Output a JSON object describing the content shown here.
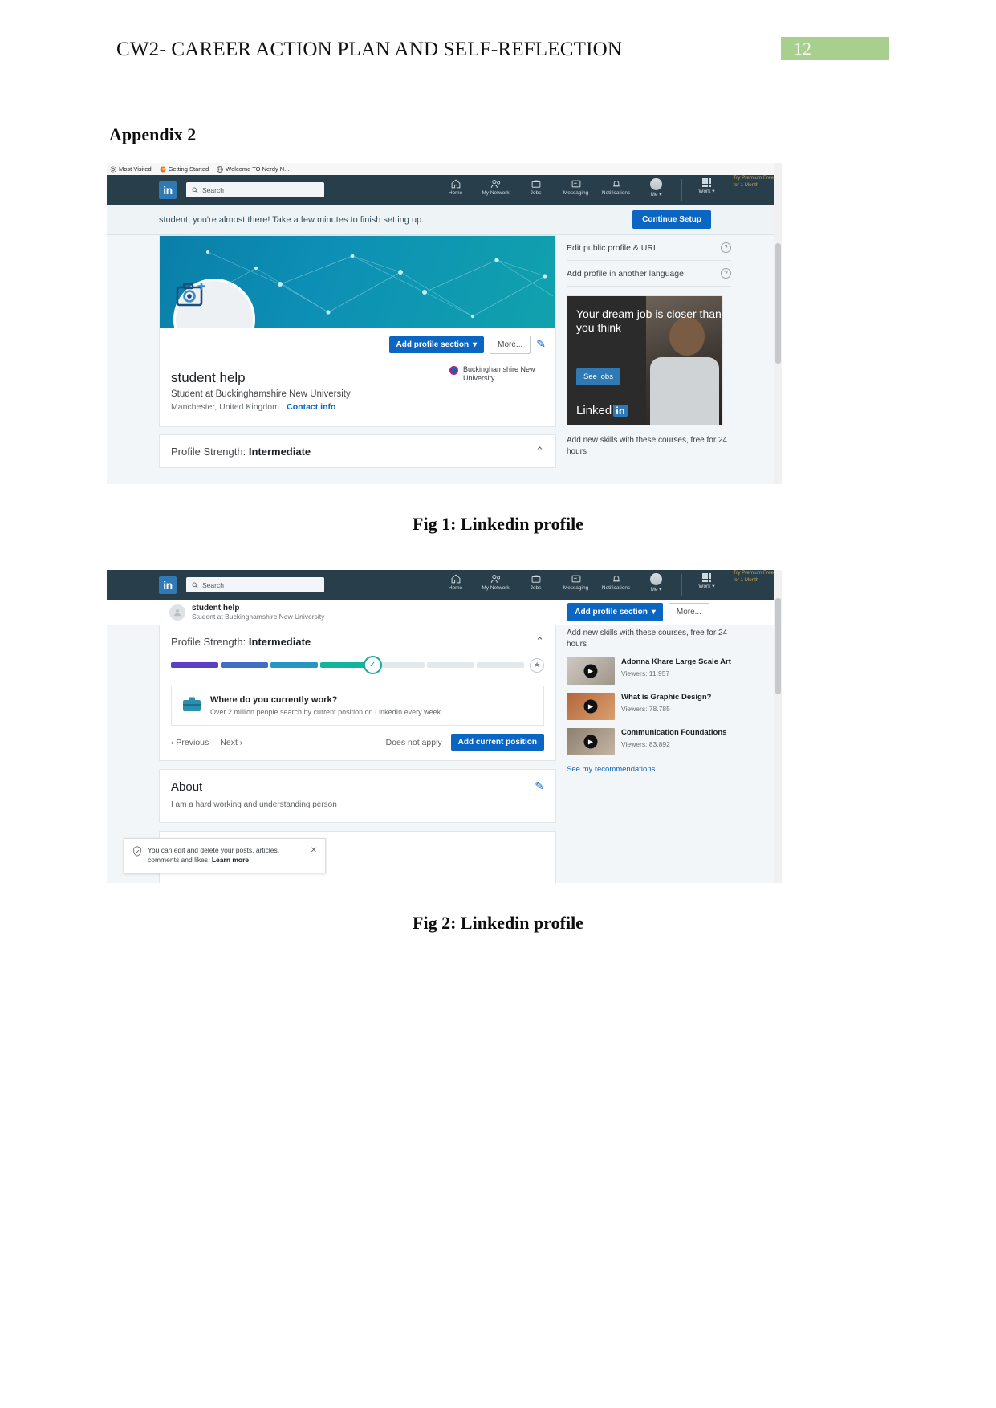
{
  "document": {
    "header_title": "CW2- CAREER ACTION PLAN AND SELF-REFLECTION",
    "page_number": "12",
    "appendix_title": "Appendix 2",
    "fig1_caption": "Fig 1: Linkedin profile",
    "fig2_caption": "Fig 2: Linkedin profile"
  },
  "browser": {
    "bookmarks": [
      {
        "label": "Most Visited",
        "icon": "gear-icon"
      },
      {
        "label": "Getting Started",
        "icon": "firefox-icon"
      },
      {
        "label": "Welcome TO Nerdy N...",
        "icon": "globe-icon"
      }
    ]
  },
  "linkedin_nav": {
    "logo": "in",
    "search_placeholder": "Search",
    "items": [
      {
        "label": "Home",
        "icon": "home-icon"
      },
      {
        "label": "My Network",
        "icon": "people-icon"
      },
      {
        "label": "Jobs",
        "icon": "briefcase-icon"
      },
      {
        "label": "Messaging",
        "icon": "message-icon"
      },
      {
        "label": "Notifications",
        "icon": "bell-icon"
      },
      {
        "label": "Me",
        "icon": "avatar-icon"
      }
    ],
    "work_label": "Work",
    "premium_line1": "Try Premium Free",
    "premium_line2": "for 1 Month"
  },
  "fig1": {
    "setup_banner": {
      "text": "student, you're almost there! Take a few minutes to finish setting up.",
      "button": "Continue Setup"
    },
    "profile": {
      "name": "student help",
      "headline": "Student at Buckinghamshire New University",
      "location": "Manchester, United Kingdom",
      "separator": "·",
      "contact_info": "Contact info",
      "school": "Buckinghamshire New University",
      "add_section_button": "Add profile section",
      "more_button": "More...",
      "edit_icon": "pencil-icon",
      "avatar_icon": "camera-add-icon"
    },
    "strength": {
      "label": "Profile Strength:",
      "value": "Intermediate"
    },
    "sidebar": {
      "links": [
        {
          "label": "Edit public profile & URL",
          "help": "?"
        },
        {
          "label": "Add profile in another language",
          "help": "?"
        }
      ],
      "ad": {
        "headline": "Your dream job is closer than you think",
        "button": "See jobs",
        "brand": "Linked",
        "brand_mark": "in"
      },
      "courses_note": "Add new skills with these courses, free for 24 hours"
    }
  },
  "fig2": {
    "sticky": {
      "name": "student help",
      "headline": "Student at Buckinghamshire New University",
      "add_section_button": "Add profile section",
      "more_button": "More..."
    },
    "strength": {
      "label": "Profile Strength:",
      "value": "Intermediate",
      "segments_filled": 4,
      "segments_total": 7,
      "check_icon": "check-circle-icon",
      "star_icon": "star-icon"
    },
    "work_prompt": {
      "question": "Where do you currently work?",
      "subtext": "Over 2 million people search by current position on LinkedIn every week",
      "previous": "Previous",
      "next": "Next",
      "does_not_apply": "Does not apply",
      "add_position": "Add current position",
      "icon": "briefcase-icon"
    },
    "about": {
      "title": "About",
      "text": "I am a hard working and understanding person",
      "edit_icon": "pencil-icon"
    },
    "toast": {
      "text_1": "You can edit and delete your posts, articles,",
      "text_2": "comments and likes.",
      "link": "Learn more",
      "shield_icon": "shield-icon",
      "close_icon": "close-icon"
    },
    "sidebar": {
      "courses_note": "Add new skills with these courses, free for 24 hours",
      "courses": [
        {
          "title": "Adonna Khare Large Scale Art",
          "viewers": "Viewers: 11.957"
        },
        {
          "title": "What is Graphic Design?",
          "viewers": "Viewers: 78.785"
        },
        {
          "title": "Communication Foundations",
          "viewers": "Viewers: 83.892"
        }
      ],
      "see_recommendations": "See my recommendations"
    }
  },
  "colors": {
    "linkedin_navy": "#283e4a",
    "linkedin_blue": "#0a66c2",
    "page_badge_green": "#a9cf8f",
    "premium_gold": "#c8a45a"
  }
}
